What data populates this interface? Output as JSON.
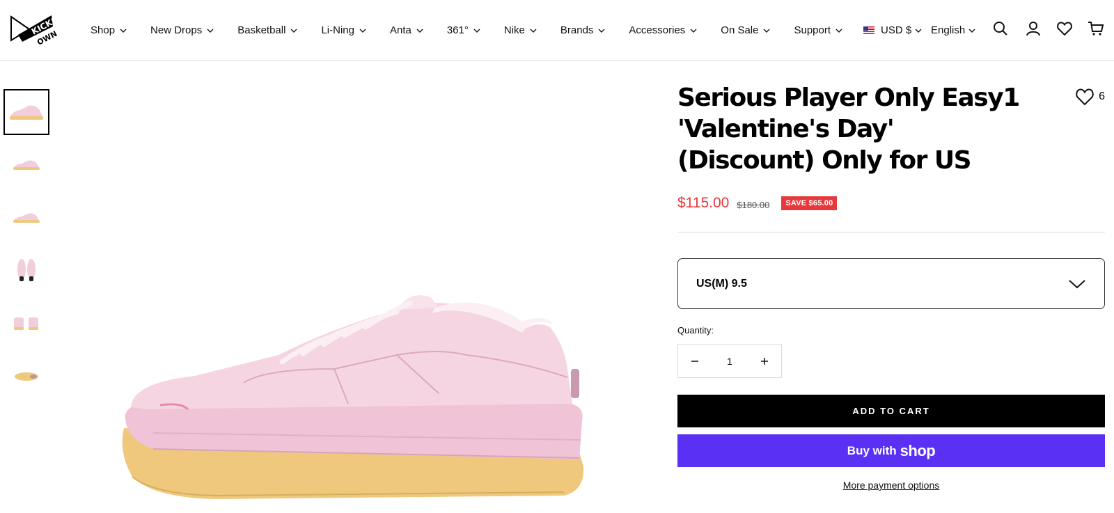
{
  "brand": {
    "logo_line1": "KICKS",
    "logo_line2": "OWN"
  },
  "nav": {
    "items": [
      {
        "label": "Shop"
      },
      {
        "label": "New Drops"
      },
      {
        "label": "Basketball"
      },
      {
        "label": "Li-Ning"
      },
      {
        "label": "Anta"
      },
      {
        "label": "361°"
      },
      {
        "label": "Nike"
      },
      {
        "label": "Brands"
      },
      {
        "label": "Accessories"
      },
      {
        "label": "On Sale"
      },
      {
        "label": "Support"
      }
    ]
  },
  "locale": {
    "currency": "USD $",
    "language": "English"
  },
  "header_icons": [
    "search-icon",
    "account-icon",
    "wishlist-icon",
    "cart-icon"
  ],
  "thumbnails": [
    {
      "view": "side-profile"
    },
    {
      "view": "side-profile-small"
    },
    {
      "view": "side-profile-small"
    },
    {
      "view": "front-pair"
    },
    {
      "view": "heel-pair"
    },
    {
      "view": "outsole"
    }
  ],
  "product": {
    "title": "Serious Player Only Easy1 'Valentine's Day'　(Discount) Only for US",
    "wishlist_count": "6",
    "price": "$115.00",
    "compare_price": "$180.00",
    "save_badge": "SAVE $65.00",
    "variant": {
      "selected": "US(M) 9.5"
    },
    "quantity_label": "Quantity:",
    "quantity": "1",
    "add_to_cart": "ADD TO CART",
    "buy_with": "Buy with",
    "buy_brand": "shop",
    "more_payment": "More payment options"
  },
  "colors": {
    "accent_sale": "#e8383b",
    "shop_pay": "#5a31f4",
    "shoe_upper": "#f2cedd",
    "shoe_sole": "#efc87e"
  }
}
